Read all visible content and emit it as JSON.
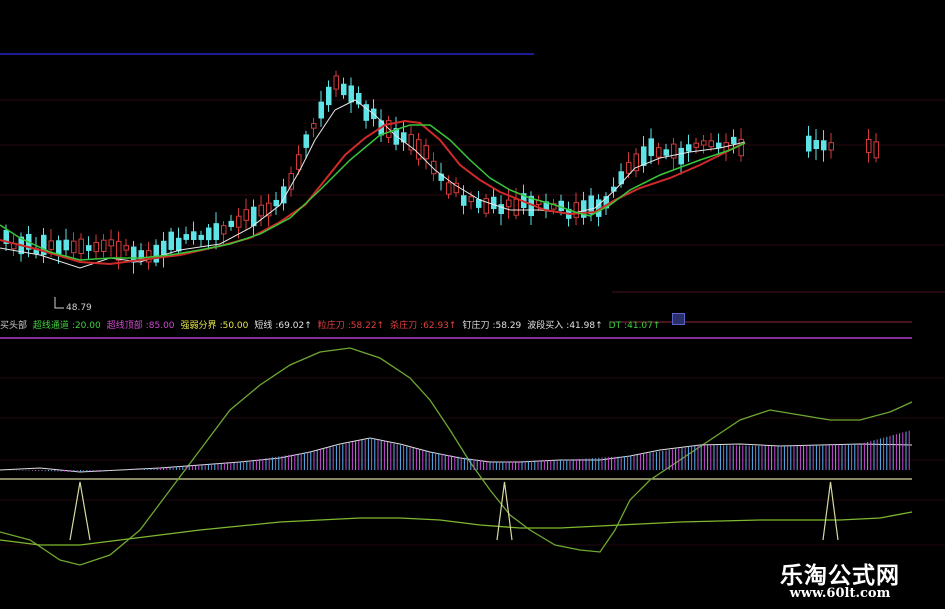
{
  "indicator_bar": {
    "title": "买头部",
    "items": [
      {
        "name": "超线通道",
        "value": "20.00",
        "color": "#3fd13f"
      },
      {
        "name": "超线顶部",
        "value": "85.00",
        "color": "#d24ad2"
      },
      {
        "name": "强弱分界",
        "value": "50.00",
        "color": "#e8e84a"
      },
      {
        "name": "短线",
        "value": "69.02↑",
        "color": "#e0e0e0"
      },
      {
        "name": "粒庄刀",
        "value": "58.22↑",
        "color": "#e24040"
      },
      {
        "name": "杀庄刀",
        "value": "62.93↑",
        "color": "#e24040"
      },
      {
        "name": "钉庄刀",
        "value": "58.29",
        "color": "#e0e0e0"
      },
      {
        "name": "波段买入",
        "value": "41.98↑",
        "color": "#e0e0e0"
      },
      {
        "name": "DT",
        "value": "41.07↑",
        "color": "#3fd13f"
      }
    ]
  },
  "price_panel": {
    "low_label": "48.79",
    "tag": "附"
  },
  "watermark": {
    "site_name": "乐淘公式网",
    "url": "www.60lt.com"
  },
  "colors": {
    "background": "#000000",
    "candle_up": "#d23a3a",
    "candle_down": "#5ee3e6",
    "ma_short": "#e8e8e8",
    "ma_mid": "#cf2a2a",
    "ma_long": "#39c639",
    "top_line": "#2020c0",
    "separator": "#b23cc8",
    "osc_green": "#6fa832",
    "osc_yellow": "#d8d8a0"
  }
}
